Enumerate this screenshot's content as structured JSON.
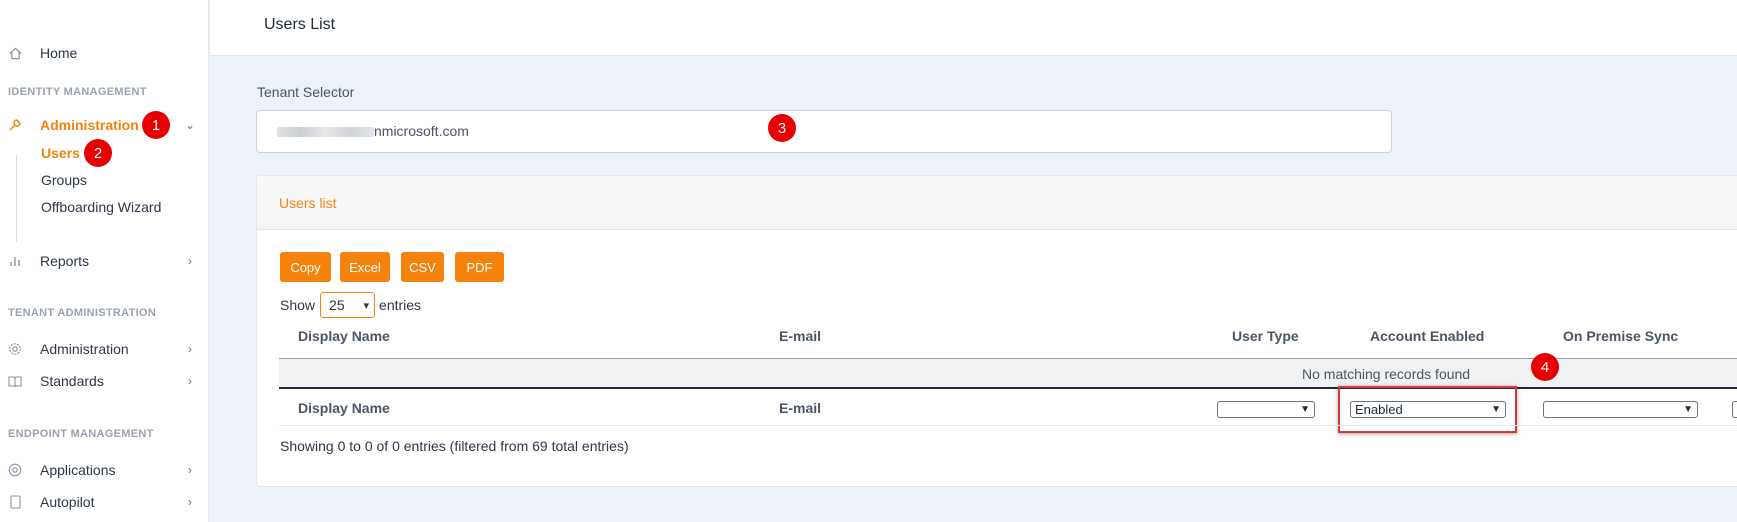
{
  "sidebar": {
    "home": {
      "label": "Home",
      "icon": "home-icon"
    },
    "identity_section": "IDENTITY MANAGEMENT",
    "administration": {
      "label": "Administration",
      "icon": "wrench-icon",
      "badge": "1"
    },
    "sub_items": [
      {
        "label": "Users",
        "badge": "2"
      },
      {
        "label": "Groups"
      },
      {
        "label": "Offboarding Wizard"
      }
    ],
    "reports": {
      "label": "Reports",
      "icon": "bar-chart-icon"
    },
    "tenant_section": "TENANT ADMINISTRATION",
    "tenant_administration": {
      "label": "Administration",
      "icon": "gear-icon"
    },
    "standards": {
      "label": "Standards",
      "icon": "book-icon"
    },
    "endpoint_section": "ENDPOINT MANAGEMENT",
    "applications": {
      "label": "Applications",
      "icon": "chrome-icon"
    },
    "autopilot": {
      "label": "Autopilot",
      "icon": "device-icon"
    }
  },
  "header": {
    "title": "Users List"
  },
  "tenant": {
    "label": "Tenant Selector",
    "value_suffix": "nmicrosoft.com",
    "badge": "3"
  },
  "card": {
    "title": "Users list",
    "buttons": [
      "Copy",
      "Excel",
      "CSV",
      "PDF"
    ],
    "show_prefix": "Show",
    "show_value": "25",
    "show_suffix": "entries",
    "columns": [
      "Display Name",
      "E-mail",
      "User Type",
      "Account Enabled",
      "On Premise Sync"
    ],
    "empty_message": "No matching records found",
    "filter_account_enabled": "Enabled",
    "filter_badge": "4",
    "info": "Showing 0 to 0 of 0 entries (filtered from 69 total entries)"
  },
  "colors": {
    "accent": "#f5830b",
    "badge": "#e60000",
    "highlight": "#d9383a"
  }
}
